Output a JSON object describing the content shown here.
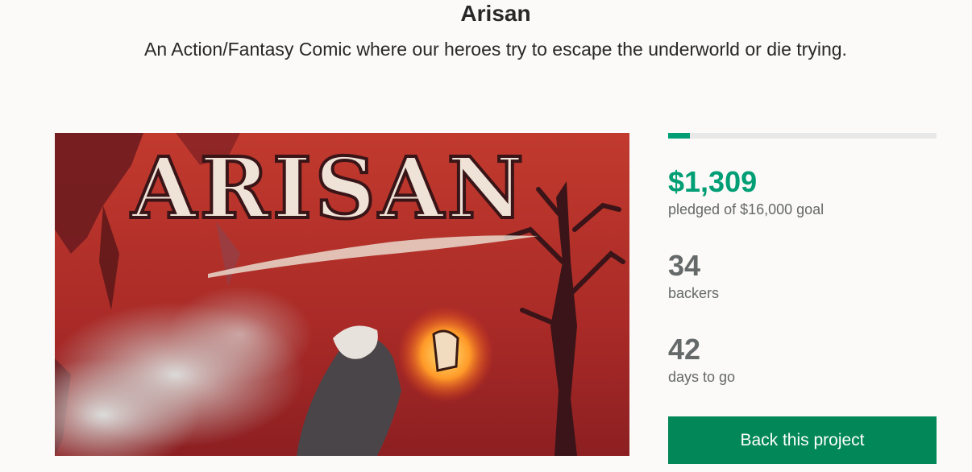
{
  "project": {
    "title": "Arisan",
    "blurb": "An Action/Fantasy Comic where our heroes try to escape the underworld or die trying.",
    "hero_logo_text": "ARISAN"
  },
  "funding": {
    "progress_fraction": 0.082,
    "pledged": "$1,309",
    "pledged_caption": "pledged of $16,000 goal",
    "backers": "34",
    "backers_caption": "backers",
    "days": "42",
    "days_caption": "days to go"
  },
  "cta": {
    "label": "Back this project"
  },
  "colors": {
    "accent": "#009e74",
    "button": "#028858",
    "stat_gray": "#656969"
  }
}
